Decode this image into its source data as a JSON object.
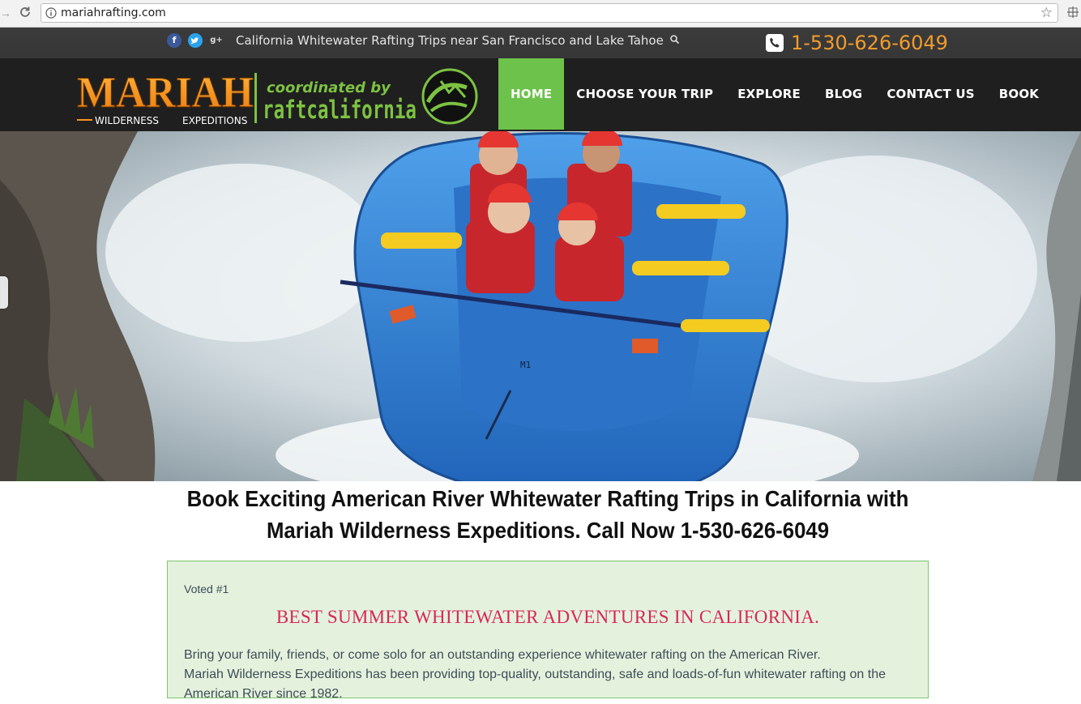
{
  "browser": {
    "url": "mariahrafting.com",
    "icons": [
      "back-arrow-icon",
      "reload-icon",
      "info-icon",
      "bookmark-star-icon",
      "extension-icon"
    ]
  },
  "topbar": {
    "social": [
      {
        "name": "facebook",
        "glyph": "f"
      },
      {
        "name": "twitter",
        "glyph": "t"
      },
      {
        "name": "google-plus",
        "glyph": "g+"
      }
    ],
    "tagline": "California Whitewater Rafting Trips near San Francisco and Lake Tahoe",
    "phone": "1-530-626-6049"
  },
  "logo": {
    "brand": "MARIAH",
    "sub_left": "WILDERNESS",
    "sub_right": "EXPEDITIONS",
    "coordinated": "coordinated by",
    "partner": "raftcalifornia"
  },
  "nav": {
    "items": [
      {
        "label": "HOME",
        "active": true
      },
      {
        "label": "CHOOSE YOUR TRIP",
        "active": false
      },
      {
        "label": "EXPLORE",
        "active": false
      },
      {
        "label": "BLOG",
        "active": false
      },
      {
        "label": "CONTACT US",
        "active": false
      },
      {
        "label": "BOOK",
        "active": false
      }
    ]
  },
  "hero": {
    "raft_tag": "M1"
  },
  "main": {
    "headline_line1": "Book Exciting American River Whitewater Rafting Trips in California with",
    "headline_line2": "Mariah Wilderness Expeditions. Call Now 1-530-626-6049",
    "promo": {
      "voted": "Voted #1",
      "title": "BEST SUMMER WHITEWATER ADVENTURES IN CALIFORNIA.",
      "line1": "Bring your family, friends, or come solo for an outstanding experience whitewater rafting on the American River.",
      "line2": "Mariah Wilderness Expeditions has been providing top-quality, outstanding, safe and loads-of-fun whitewater rafting on the",
      "line3": "American River since 1982."
    }
  },
  "colors": {
    "nav_active": "#6cc24a",
    "phone": "#f29b2c",
    "promo_title": "#d8275a",
    "promo_bg": "#e4f2dd",
    "logo_orange": "#f7941d",
    "logo_green": "#7dc242"
  }
}
